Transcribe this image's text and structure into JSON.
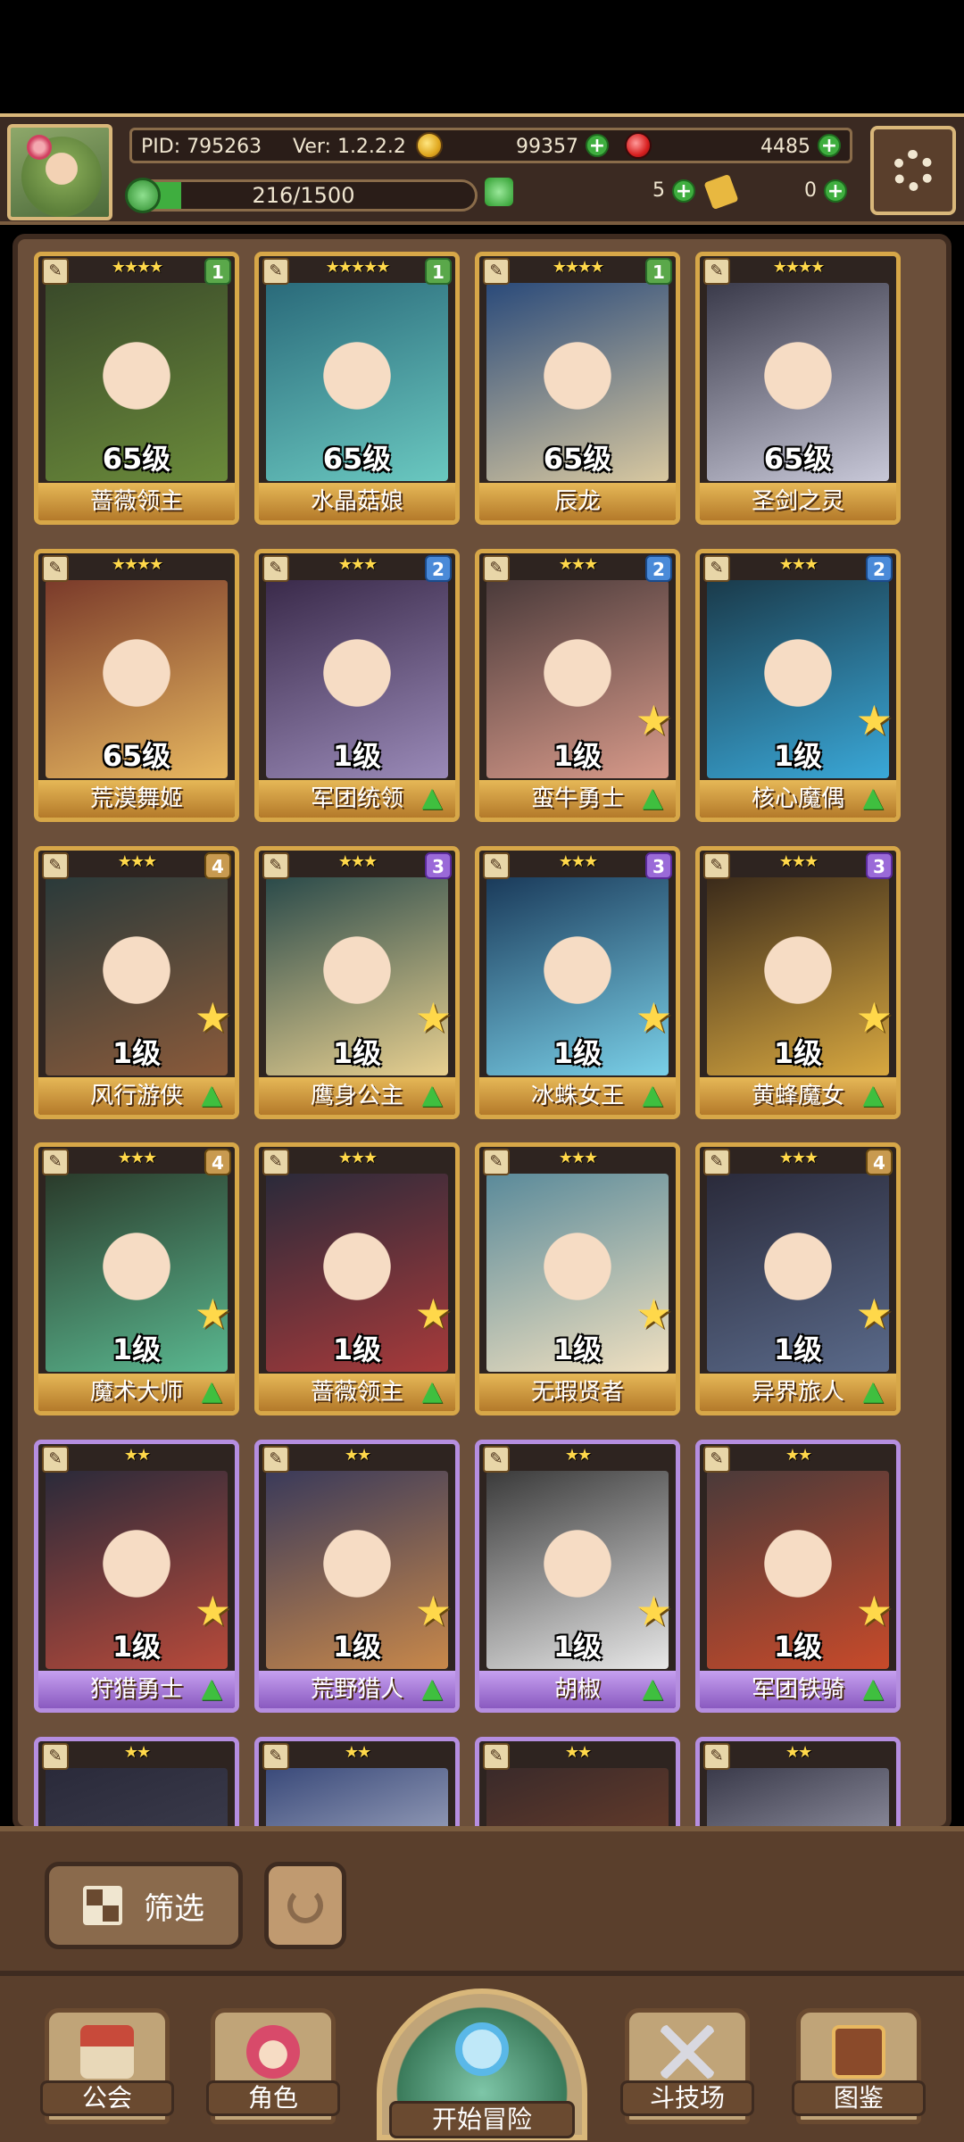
{
  "player": {
    "pid": "PID: 795263",
    "version": "Ver: 1.2.2.2",
    "gold": "99357",
    "gems": "4485",
    "xp_text": "216/1500",
    "xp_fraction": 0.144,
    "clover": "5",
    "key": "0"
  },
  "cards": [
    {
      "level": "65级",
      "name": "蔷薇领主",
      "stars": "★★★★",
      "badge": "1",
      "badge_class": "b1",
      "frame": "gold",
      "colors": [
        "#3a4a2a",
        "#6a8a3a"
      ],
      "bigstar": false,
      "upgrade": false
    },
    {
      "level": "65级",
      "name": "水晶菇娘",
      "stars": "★★★★★",
      "badge": "1",
      "badge_class": "b1",
      "frame": "gold",
      "colors": [
        "#2a6a7a",
        "#6ac8c0"
      ],
      "bigstar": false,
      "upgrade": false
    },
    {
      "level": "65级",
      "name": "辰龙",
      "stars": "★★★★",
      "badge": "1",
      "badge_class": "b1",
      "frame": "gold",
      "colors": [
        "#2a4a7a",
        "#d8c8a0"
      ],
      "bigstar": false,
      "upgrade": false
    },
    {
      "level": "65级",
      "name": "圣剑之灵",
      "stars": "★★★★",
      "badge": "",
      "badge_class": "",
      "frame": "gold",
      "colors": [
        "#3a3a4a",
        "#c8c8d8"
      ],
      "bigstar": false,
      "upgrade": false
    },
    {
      "level": "65级",
      "name": "荒漠舞姬",
      "stars": "★★★★",
      "badge": "",
      "badge_class": "",
      "frame": "gold",
      "colors": [
        "#7a3a2a",
        "#e8b860"
      ],
      "bigstar": false,
      "upgrade": false
    },
    {
      "level": "1级",
      "name": "军团统领",
      "stars": "★★★",
      "badge": "2",
      "badge_class": "b2",
      "frame": "gold",
      "colors": [
        "#3a2a4a",
        "#9a8ab8"
      ],
      "bigstar": false,
      "upgrade": true
    },
    {
      "level": "1级",
      "name": "蛮牛勇士",
      "stars": "★★★",
      "badge": "2",
      "badge_class": "b2",
      "frame": "gold",
      "colors": [
        "#4a3a3a",
        "#d89a8a"
      ],
      "bigstar": true,
      "upgrade": true
    },
    {
      "level": "1级",
      "name": "核心魔偶",
      "stars": "★★★",
      "badge": "2",
      "badge_class": "b2",
      "frame": "gold",
      "colors": [
        "#1a3a4a",
        "#3aa8d8"
      ],
      "bigstar": true,
      "upgrade": true
    },
    {
      "level": "1级",
      "name": "风行游侠",
      "stars": "★★★",
      "badge": "4",
      "badge_class": "b4",
      "frame": "gold",
      "colors": [
        "#2a3a3a",
        "#8a5a3a"
      ],
      "bigstar": true,
      "upgrade": true
    },
    {
      "level": "1级",
      "name": "鹰身公主",
      "stars": "★★★",
      "badge": "3",
      "badge_class": "b3",
      "frame": "gold",
      "colors": [
        "#2a4a4a",
        "#e8d090"
      ],
      "bigstar": true,
      "upgrade": true
    },
    {
      "level": "1级",
      "name": "冰蛛女王",
      "stars": "★★★",
      "badge": "3",
      "badge_class": "b3",
      "frame": "gold",
      "colors": [
        "#1a3a5a",
        "#7ad0e8"
      ],
      "bigstar": true,
      "upgrade": true
    },
    {
      "level": "1级",
      "name": "黄蜂魔女",
      "stars": "★★★",
      "badge": "3",
      "badge_class": "b3",
      "frame": "gold",
      "colors": [
        "#3a2a1a",
        "#d8a840"
      ],
      "bigstar": true,
      "upgrade": true
    },
    {
      "level": "1级",
      "name": "魔术大师",
      "stars": "★★★",
      "badge": "4",
      "badge_class": "b4",
      "frame": "gold",
      "colors": [
        "#2a3a2a",
        "#5ab890"
      ],
      "bigstar": true,
      "upgrade": true
    },
    {
      "level": "1级",
      "name": "蔷薇领主",
      "stars": "★★★",
      "badge": "",
      "badge_class": "",
      "frame": "gold",
      "colors": [
        "#2a2a3a",
        "#a83a3a"
      ],
      "bigstar": true,
      "upgrade": true
    },
    {
      "level": "1级",
      "name": "无瑕贤者",
      "stars": "★★★",
      "badge": "",
      "badge_class": "",
      "frame": "gold",
      "colors": [
        "#5a8a9a",
        "#f0e0c0"
      ],
      "bigstar": true,
      "upgrade": false
    },
    {
      "level": "1级",
      "name": "异界旅人",
      "stars": "★★★",
      "badge": "4",
      "badge_class": "b4",
      "frame": "gold",
      "colors": [
        "#2a2a3a",
        "#5a6a8a"
      ],
      "bigstar": true,
      "upgrade": true
    },
    {
      "level": "1级",
      "name": "狩猎勇士",
      "stars": "★★",
      "badge": "",
      "badge_class": "",
      "frame": "purple",
      "colors": [
        "#2a2a3a",
        "#b84a3a"
      ],
      "bigstar": true,
      "upgrade": true
    },
    {
      "level": "1级",
      "name": "荒野猎人",
      "stars": "★★",
      "badge": "",
      "badge_class": "",
      "frame": "purple",
      "colors": [
        "#3a3a5a",
        "#c8884a"
      ],
      "bigstar": true,
      "upgrade": true
    },
    {
      "level": "1级",
      "name": "胡椒",
      "stars": "★★",
      "badge": "",
      "badge_class": "",
      "frame": "purple",
      "colors": [
        "#3a3a3a",
        "#e8e8e8"
      ],
      "bigstar": true,
      "upgrade": true
    },
    {
      "level": "1级",
      "name": "军团铁骑",
      "stars": "★★",
      "badge": "",
      "badge_class": "",
      "frame": "purple",
      "colors": [
        "#4a3a3a",
        "#c84a2a"
      ],
      "bigstar": true,
      "upgrade": true
    },
    {
      "level": "",
      "name": "",
      "stars": "★★",
      "badge": "",
      "badge_class": "",
      "frame": "purple",
      "colors": [
        "#2a2a3a",
        "#4a4a5a"
      ],
      "bigstar": false,
      "upgrade": false
    },
    {
      "level": "",
      "name": "",
      "stars": "★★",
      "badge": "",
      "badge_class": "",
      "frame": "purple",
      "colors": [
        "#3a4a7a",
        "#e8e8f0"
      ],
      "bigstar": false,
      "upgrade": false
    },
    {
      "level": "",
      "name": "",
      "stars": "★★",
      "badge": "",
      "badge_class": "",
      "frame": "purple",
      "colors": [
        "#3a2a2a",
        "#8a4a2a"
      ],
      "bigstar": false,
      "upgrade": false
    },
    {
      "level": "",
      "name": "",
      "stars": "★★",
      "badge": "",
      "badge_class": "",
      "frame": "purple",
      "colors": [
        "#3a3a4a",
        "#d8d8e8"
      ],
      "bigstar": false,
      "upgrade": false
    }
  ],
  "controls": {
    "filter_label": "筛选"
  },
  "nav": {
    "guild": "公会",
    "character": "角色",
    "adventure": "开始冒险",
    "arena": "斗技场",
    "codex": "图鉴"
  }
}
